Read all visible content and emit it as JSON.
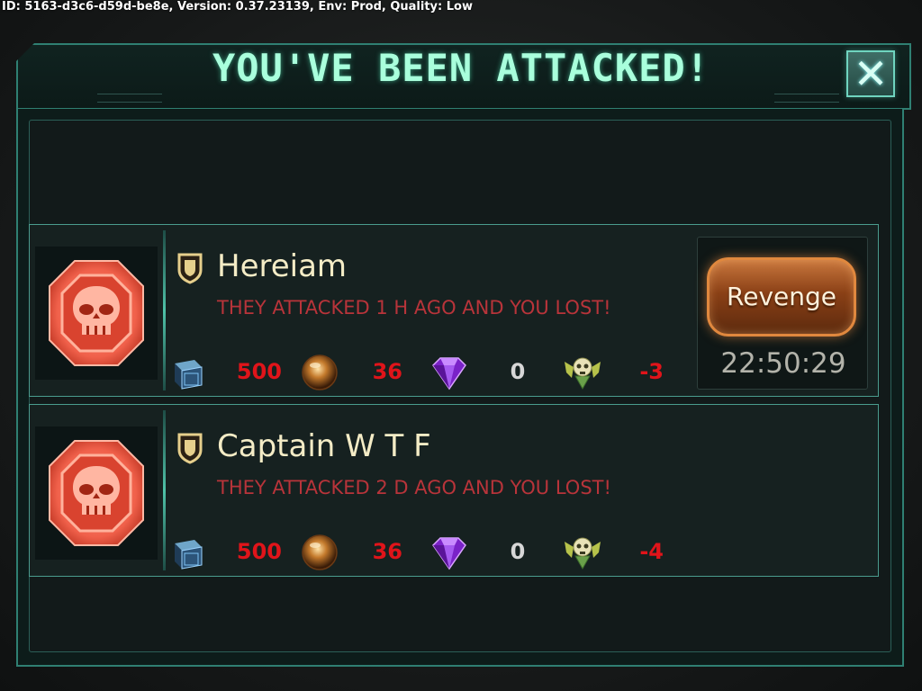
{
  "debug_text": "ID: 5163-d3c6-d59d-be8e, Version: 0.37.23139, Env: Prod, Quality: Low",
  "dialog": {
    "title": "YOU'VE BEEN ATTACKED!",
    "close_icon": "close-x-icon"
  },
  "colors": {
    "accent": "#a9ffdc",
    "frame": "#2f7f72",
    "loss_text": "#b8343a",
    "negative_value": "#e0141a",
    "revenge_orange": "#e0883e"
  },
  "attacks": [
    {
      "name": "Hereiam",
      "message": "THEY ATTACKED 1 H AGO AND YOU LOST!",
      "resources": {
        "crystal": "500",
        "ore": "36",
        "gem": "0",
        "medal": "-3"
      },
      "revenge_label": "Revenge",
      "timer": "22:50:29"
    },
    {
      "name": "Captain W T F",
      "message": "THEY ATTACKED 2 D AGO AND YOU LOST!",
      "resources": {
        "crystal": "500",
        "ore": "36",
        "gem": "0",
        "medal": "-4"
      }
    }
  ],
  "icons": {
    "avatar": "skull-icon",
    "alliance": "shield-icon",
    "crystal": "crystal-cube-icon",
    "ore": "ore-orb-icon",
    "gem": "purple-gem-icon",
    "medal": "skull-medal-icon"
  }
}
